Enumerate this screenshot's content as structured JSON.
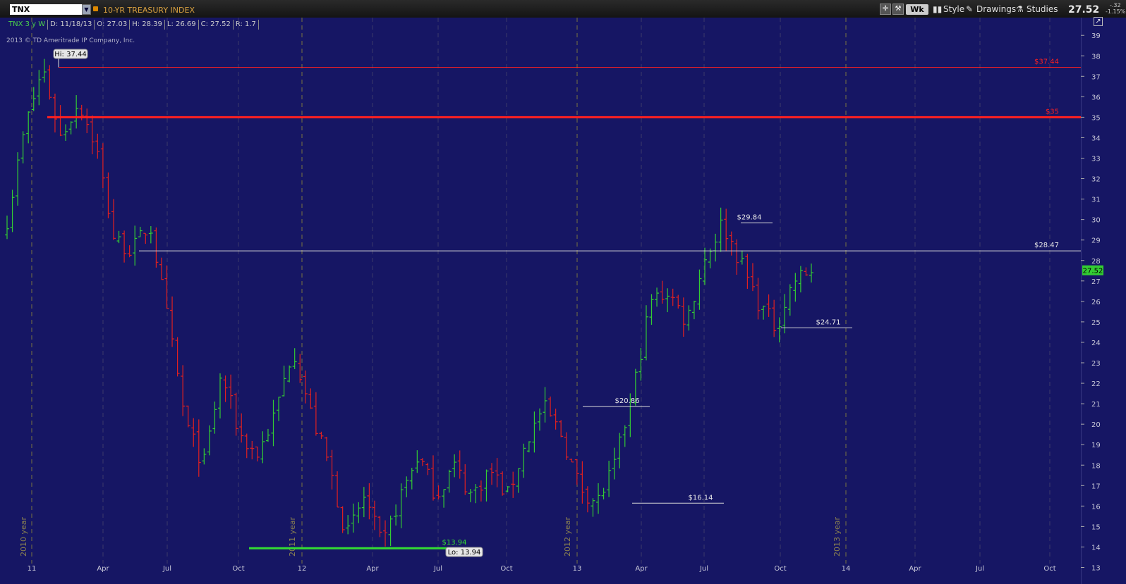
{
  "toolbar": {
    "symbol": "TNX",
    "index_name": "10-YR TREASURY INDEX",
    "aggregation": "Wk",
    "style_label": "Style",
    "drawings_label": "Drawings",
    "studies_label": "Studies",
    "last_price": "27.52",
    "change": "-.32",
    "change_pct": "-1.15%"
  },
  "infobar": {
    "symbol_period": "TNX 3 y W",
    "date": "D: 11/18/13",
    "open": "O: 27.03",
    "high": "H: 28.39",
    "low": "L: 26.69",
    "close": "C: 27.52",
    "range": "R: 1.7"
  },
  "copyright": "2013 © TD Ameritrade IP Company, Inc.",
  "colors": {
    "up": "#33cc33",
    "down": "#e02020",
    "background": "#161664",
    "resistance": "#ff2020",
    "support": "#33dd33",
    "marker": "#d8d8d8"
  },
  "chart_data": {
    "type": "ohlc",
    "frequency": "weekly",
    "ylim": [
      13,
      39
    ],
    "yticks": [
      13,
      14,
      15,
      16,
      17,
      18,
      19,
      20,
      21,
      22,
      23,
      24,
      25,
      26,
      27,
      28,
      29,
      30,
      31,
      32,
      33,
      34,
      35,
      36,
      37,
      38,
      39
    ],
    "x_tick_labels": [
      "11",
      "Apr",
      "Jul",
      "Oct",
      "12",
      "Apr",
      "Jul",
      "Oct",
      "13",
      "Apr",
      "Jul",
      "Oct",
      "14",
      "Apr",
      "Jul",
      "Oct"
    ],
    "year_labels": [
      "2010 year",
      "2011 year",
      "2012 year",
      "2013 year"
    ],
    "annotations": {
      "hi_badge": "Hi: 37.44",
      "lo_badge": "Lo: 13.94",
      "last_badge": "27.52"
    },
    "levels": [
      {
        "label": "$37.44",
        "value": 37.44,
        "color": "#ff2020",
        "style": "thin"
      },
      {
        "label": "$35",
        "value": 35,
        "color": "#ff2020",
        "style": "thick"
      },
      {
        "label": "$28.47",
        "value": 28.47,
        "color": "#d8d8d8",
        "style": "thin"
      },
      {
        "label": "$13.94",
        "value": 13.94,
        "color": "#33dd33",
        "style": "thick"
      },
      {
        "label": "$29.84",
        "value": 29.84,
        "color": "#d8d8d8",
        "style": "short"
      },
      {
        "label": "$24.71",
        "value": 24.71,
        "color": "#d8d8d8",
        "style": "short"
      },
      {
        "label": "$20.86",
        "value": 20.86,
        "color": "#d8d8d8",
        "style": "short"
      },
      {
        "label": "$16.14",
        "value": 16.14,
        "color": "#d8d8d8",
        "style": "short"
      }
    ],
    "waypoints": [
      30.0,
      34.5,
      37.44,
      34.0,
      35.8,
      33.5,
      29.0,
      28.5,
      29.8,
      25.0,
      20.0,
      18.0,
      22.5,
      19.5,
      18.5,
      20.5,
      23.8,
      20.5,
      18.0,
      14.5,
      16.5,
      13.94,
      16.5,
      18.5,
      16.5,
      18.0,
      16.5,
      17.8,
      16.5,
      19.0,
      20.86,
      19.5,
      17.0,
      16.14,
      18.0,
      21.5,
      26.0,
      26.5,
      25.0,
      28.0,
      29.84,
      28.0,
      26.0,
      24.71,
      27.0,
      27.52
    ]
  }
}
